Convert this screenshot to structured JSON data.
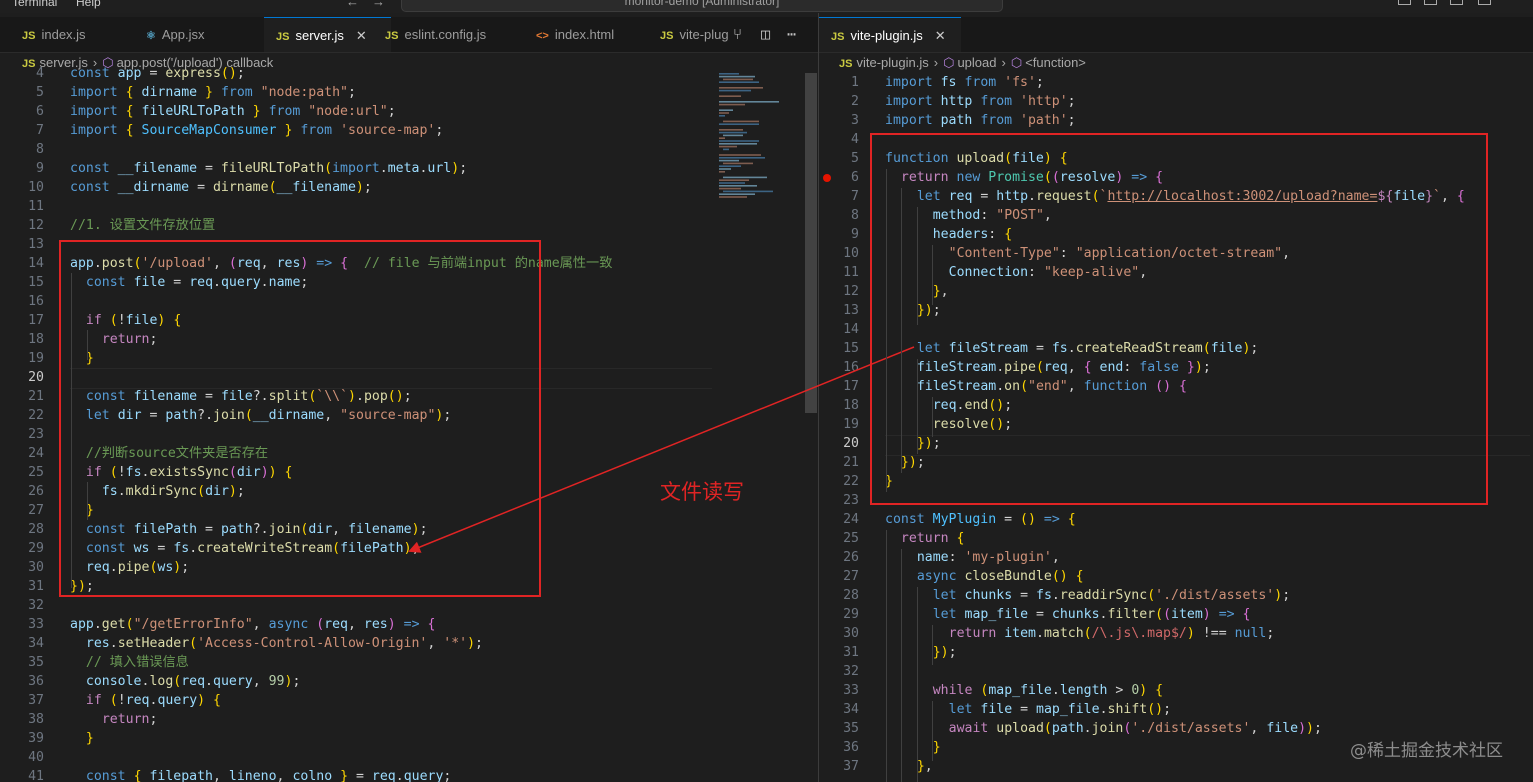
{
  "titlebar": {
    "menu": [
      "Terminal",
      "Help"
    ],
    "command_center": "monitor-demo [Administrator]"
  },
  "left_tabs": [
    {
      "icon": "JS",
      "label": "index.js"
    },
    {
      "icon": "⚛",
      "label": "App.jsx"
    },
    {
      "icon": "JS",
      "label": "server.js",
      "close": "✕"
    },
    {
      "icon": "JS",
      "label": "eslint.config.js"
    },
    {
      "icon": "<>",
      "label": "index.html"
    },
    {
      "icon": "JS",
      "label": "vite-plug"
    }
  ],
  "left_actions": {
    "compare": "⑂",
    "split": "◫",
    "more": "⋯"
  },
  "right_tabs": [
    {
      "icon": "JS",
      "label": "vite-plugin.js",
      "close": "✕"
    }
  ],
  "left_breadcrumb": {
    "icon": "JS",
    "file": "server.js",
    "symbol": "app.post('/upload') callback"
  },
  "right_breadcrumb": {
    "icon": "JS",
    "file": "vite-plugin.js",
    "symbol1": "upload",
    "symbol2": "<function>"
  },
  "left_lines": [
    {
      "n": "4",
      "t": "const app = express();"
    },
    {
      "n": "5",
      "t": "import { dirname } from \"node:path\";"
    },
    {
      "n": "6",
      "t": "import { fileURLToPath } from \"node:url\";"
    },
    {
      "n": "7",
      "t": "import { SourceMapConsumer } from 'source-map';"
    },
    {
      "n": "8",
      "t": ""
    },
    {
      "n": "9",
      "t": "const __filename = fileURLToPath(import.meta.url);"
    },
    {
      "n": "10",
      "t": "const __dirname = dirname(__filename);"
    },
    {
      "n": "11",
      "t": ""
    },
    {
      "n": "12",
      "t": "//1. 设置文件存放位置"
    },
    {
      "n": "13",
      "t": ""
    },
    {
      "n": "14",
      "t": "app.post('/upload', (req, res) => {  // file 与前端input 的name属性一致"
    },
    {
      "n": "15",
      "t": "  const file = req.query.name;"
    },
    {
      "n": "16",
      "t": ""
    },
    {
      "n": "17",
      "t": "  if (!file) {"
    },
    {
      "n": "18",
      "t": "    return;"
    },
    {
      "n": "19",
      "t": "  }"
    },
    {
      "n": "20",
      "t": ""
    },
    {
      "n": "21",
      "t": "  const filename = file?.split(`\\\\`).pop();"
    },
    {
      "n": "22",
      "t": "  let dir = path?.join(__dirname, \"source-map\");"
    },
    {
      "n": "23",
      "t": ""
    },
    {
      "n": "24",
      "t": "  //判断source文件夹是否存在"
    },
    {
      "n": "25",
      "t": "  if (!fs.existsSync(dir)) {"
    },
    {
      "n": "26",
      "t": "    fs.mkdirSync(dir);"
    },
    {
      "n": "27",
      "t": "  }"
    },
    {
      "n": "28",
      "t": "  const filePath = path?.join(dir, filename);"
    },
    {
      "n": "29",
      "t": "  const ws = fs.createWriteStream(filePath);"
    },
    {
      "n": "30",
      "t": "  req.pipe(ws);"
    },
    {
      "n": "31",
      "t": "});"
    },
    {
      "n": "32",
      "t": ""
    },
    {
      "n": "33",
      "t": "app.get(\"/getErrorInfo\", async (req, res) => {"
    },
    {
      "n": "34",
      "t": "  res.setHeader('Access-Control-Allow-Origin', '*');"
    },
    {
      "n": "35",
      "t": "  // 填入错误信息"
    },
    {
      "n": "36",
      "t": "  console.log(req.query, 99);"
    },
    {
      "n": "37",
      "t": "  if (!req.query) {"
    },
    {
      "n": "38",
      "t": "    return;"
    },
    {
      "n": "39",
      "t": "  }"
    },
    {
      "n": "40",
      "t": ""
    },
    {
      "n": "41",
      "t": "  const { filepath, lineno, colno } = req.query;"
    }
  ],
  "right_lines": [
    {
      "n": "1",
      "t": "import fs from 'fs';"
    },
    {
      "n": "2",
      "t": "import http from 'http';"
    },
    {
      "n": "3",
      "t": "import path from 'path';"
    },
    {
      "n": "4",
      "t": ""
    },
    {
      "n": "5",
      "t": "function upload(file) {"
    },
    {
      "n": "6",
      "t": "  return new Promise((resolve) => {"
    },
    {
      "n": "7",
      "t": "    let req = http.request(`http://localhost:3002/upload?name=${file}`, {"
    },
    {
      "n": "8",
      "t": "      method: \"POST\","
    },
    {
      "n": "9",
      "t": "      headers: {"
    },
    {
      "n": "10",
      "t": "        \"Content-Type\": \"application/octet-stream\","
    },
    {
      "n": "11",
      "t": "        Connection: \"keep-alive\","
    },
    {
      "n": "12",
      "t": "      },"
    },
    {
      "n": "13",
      "t": "    });"
    },
    {
      "n": "14",
      "t": ""
    },
    {
      "n": "15",
      "t": "    let fileStream = fs.createReadStream(file);"
    },
    {
      "n": "16",
      "t": "    fileStream.pipe(req, { end: false });"
    },
    {
      "n": "17",
      "t": "    fileStream.on(\"end\", function () {"
    },
    {
      "n": "18",
      "t": "      req.end();"
    },
    {
      "n": "19",
      "t": "      resolve();"
    },
    {
      "n": "20",
      "t": "    });"
    },
    {
      "n": "21",
      "t": "  });"
    },
    {
      "n": "22",
      "t": "}"
    },
    {
      "n": "23",
      "t": ""
    },
    {
      "n": "24",
      "t": "const MyPlugin = () => {"
    },
    {
      "n": "25",
      "t": "  return {"
    },
    {
      "n": "26",
      "t": "    name: 'my-plugin',"
    },
    {
      "n": "27",
      "t": "    async closeBundle() {"
    },
    {
      "n": "28",
      "t": "      let chunks = fs.readdirSync('./dist/assets');"
    },
    {
      "n": "29",
      "t": "      let map_file = chunks.filter((item) => {"
    },
    {
      "n": "30",
      "t": "        return item.match(/\\.js\\.map$/) !== null;"
    },
    {
      "n": "31",
      "t": "      });"
    },
    {
      "n": "32",
      "t": ""
    },
    {
      "n": "33",
      "t": "      while (map_file.length > 0) {"
    },
    {
      "n": "34",
      "t": "        let file = map_file.shift();"
    },
    {
      "n": "35",
      "t": "        await upload(path.join('./dist/assets', file));"
    },
    {
      "n": "36",
      "t": "      }"
    },
    {
      "n": "37",
      "t": "    },"
    }
  ],
  "annotation": "文件读写",
  "watermark": "@稀土掘金技术社区",
  "colors": {
    "annotation_red": "#e02424",
    "editor_bg": "#1e1e1e",
    "tab_active_border": "#0078d4"
  }
}
